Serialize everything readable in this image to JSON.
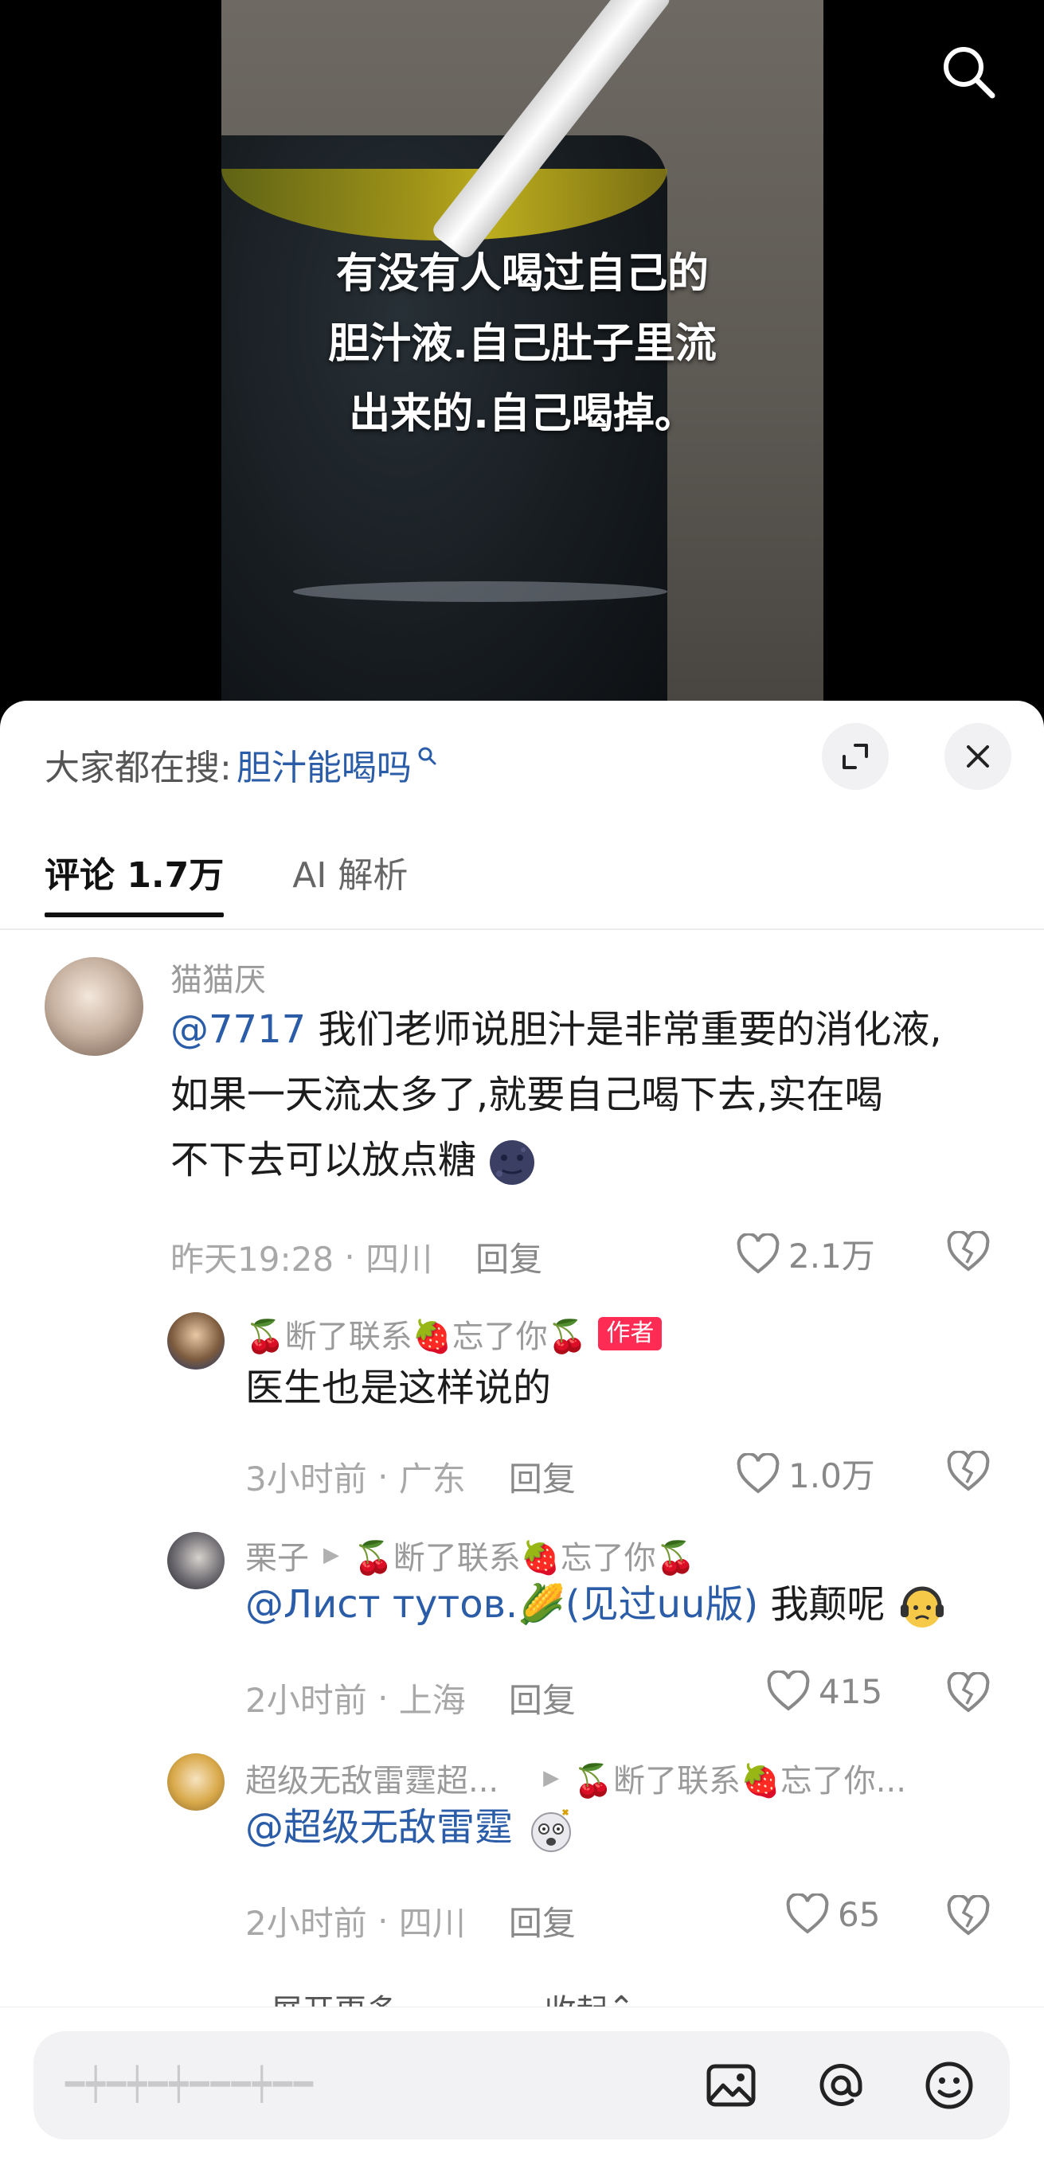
{
  "video": {
    "caption_lines": [
      "有没有人喝过自己的",
      "胆汁液.自己肚子里流",
      "出来的.自己喝掉。"
    ],
    "search_icon": "search-icon"
  },
  "sheet": {
    "trending_label": "大家都在搜:",
    "trending_term": "胆汁能喝吗",
    "tabs": [
      {
        "label": "评论 1.7万"
      },
      {
        "label": "AI 解析"
      }
    ]
  },
  "comments": [
    {
      "user": "猫猫厌",
      "mention": "@7717",
      "text_line1": " 我们老师说胆汁是非常重要的消化液,",
      "text_line2": "如果一天流太多了,就要自己喝下去,实在喝",
      "text_line3": "不下去可以放点糖",
      "time": "昨天19:28",
      "location": "四川",
      "reply": "回复",
      "likes": "2.1万"
    },
    {
      "user": "🍒断了联系🍓忘了你🍒",
      "badge": "作者",
      "text": "医生也是这样说的",
      "time": "3小时前",
      "location": "广东",
      "reply": "回复",
      "likes": "1.0万"
    },
    {
      "user": "栗子",
      "reply_to": "🍒断了联系🍓忘了你🍒",
      "mention": "@Лист тутов.🌽(见过uu版)",
      "text": "我颠呢",
      "time": "2小时前",
      "location": "上海",
      "reply": "回复",
      "likes": "415"
    },
    {
      "user": "超级无敌雷霆超...",
      "reply_to": "🍒断了联系🍓忘了你...",
      "mention": "@超级无敌雷霆",
      "time": "2小时前",
      "location": "四川",
      "reply": "回复",
      "likes": "65"
    }
  ],
  "thread": {
    "expand_more": "展开更多",
    "collapse": "收起"
  },
  "input": {
    "placeholder": "━┿━┿━┿━━━┿━━"
  }
}
